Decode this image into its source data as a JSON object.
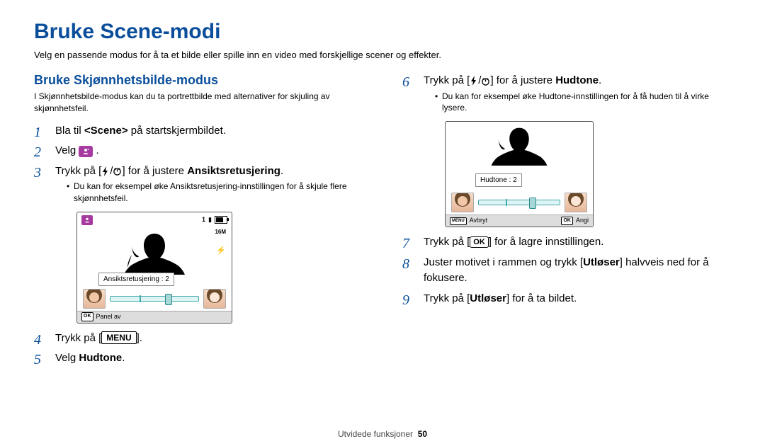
{
  "title": "Bruke Scene-modi",
  "intro": "Velg en passende modus for å ta et bilde eller spille inn en video med forskjellige scener og effekter.",
  "left": {
    "heading": "Bruke Skjønnhetsbilde-modus",
    "sub": "I Skjønnhetsbilde-modus kan du ta portrettbilde med alternativer for skjuling av skjønnhetsfeil.",
    "step1_a": "Bla til ",
    "step1_scene": "<Scene>",
    "step1_b": " på startskjermbildet.",
    "step2": "Velg ",
    "step3_a": "Trykk på [",
    "step3_b": "] for å justere ",
    "step3_bold": "Ansiktsretusjering",
    "note3": "Du kan for eksempel øke Ansiktsretusjering-innstillingen for å skjule flere skjønnhetsfeil.",
    "screen_label": "Ansiktsretusjering : 2",
    "screen_mp": "16M",
    "panel": "Panel av",
    "step4_a": "Trykk på [",
    "step4_key": "MENU",
    "step4_b": "].",
    "step5_a": "Velg ",
    "step5_bold": "Hudtone",
    "step5_b": "."
  },
  "right": {
    "step6_a": "Trykk på [",
    "step6_b": "] for å justere ",
    "step6_bold": "Hudtone",
    "note6": "Du kan for eksempel øke Hudtone-innstillingen for å få huden til å virke lysere.",
    "screen_label": "Hudtone : 2",
    "bb_cancel": "Avbryt",
    "bb_set": "Angi",
    "step7_a": "Trykk på [",
    "step7_b": "] for å lagre innstillingen.",
    "step8_a": "Juster motivet i rammen og trykk [",
    "step8_key": "Utløser",
    "step8_b": "] halvveis ned for å fokusere.",
    "step9_a": "Trykk på [",
    "step9_key": "Utløser",
    "step9_b": "] for å ta bildet."
  },
  "footer_a": "Utvidede funksjoner",
  "footer_page": "50"
}
